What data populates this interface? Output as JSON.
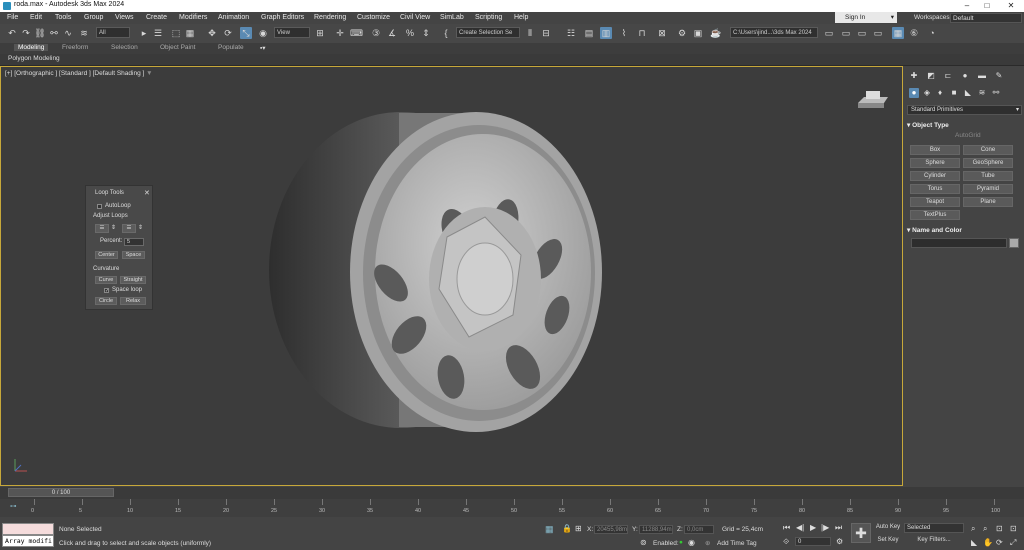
{
  "window": {
    "title": "roda.max - Autodesk 3ds Max 2024",
    "minimize": "–",
    "maximize": "□",
    "close": "✕"
  },
  "menu": [
    "File",
    "Edit",
    "Tools",
    "Group",
    "Views",
    "Create",
    "Modifiers",
    "Animation",
    "Graph Editors",
    "Rendering",
    "Customize",
    "Civil View",
    "SimLab",
    "Scripting",
    "Help"
  ],
  "signin": "Sign In",
  "workspaces": {
    "label": "Workspaces:",
    "value": "Default"
  },
  "toolbar": {
    "filter": "All",
    "refcoord": "View",
    "selection_set": "Create Selection Se",
    "path": "C:\\Users\\jind...\\3ds Max 2024"
  },
  "ribbon": {
    "tabs": [
      "Modeling",
      "Freeform",
      "Selection",
      "Object Paint",
      "Populate"
    ],
    "active": "Modeling",
    "panel": "Polygon Modeling"
  },
  "viewport": {
    "label": "[+] [Orthographic ] [Standard ] [Default Shading ]"
  },
  "loop_tools": {
    "title": "Loop Tools",
    "autoloop": "AutoLoop",
    "adjust_loops": "Adjust Loops",
    "percent_label": "Percent:",
    "percent_value": "5",
    "center": "Center",
    "space": "Space",
    "curvature": "Curvature",
    "curve": "Curve",
    "straight": "Straight",
    "space_loop": "Space loop",
    "circle": "Circle",
    "relax": "Relax"
  },
  "command_panel": {
    "category": "Standard Primitives",
    "object_type_title": "Object Type",
    "autogrid": "AutoGrid",
    "buttons": [
      "Box",
      "Cone",
      "Sphere",
      "GeoSphere",
      "Cylinder",
      "Tube",
      "Torus",
      "Pyramid",
      "Teapot",
      "Plane",
      "TextPlus"
    ],
    "name_color_title": "Name and Color"
  },
  "timeline": {
    "slider": "0 / 100",
    "ticks": [
      "0",
      "5",
      "10",
      "15",
      "20",
      "25",
      "30",
      "35",
      "40",
      "45",
      "50",
      "55",
      "60",
      "65",
      "70",
      "75",
      "80",
      "85",
      "90",
      "95",
      "100"
    ]
  },
  "status": {
    "maxscript": "Array modifi",
    "selected": "None Selected",
    "prompt": "Click and drag to select and scale objects (uniformly)",
    "x_label": "X:",
    "x_value": "20455,98m",
    "y_label": "Y:",
    "y_value": "11288,94m",
    "z_label": "Z:",
    "z_value": "0,0cm",
    "grid": "Grid = 25,4cm",
    "enabled": "Enabled:",
    "add_time_tag": "Add Time Tag",
    "auto_key": "Auto Key",
    "set_key": "Set Key",
    "selected_dd": "Selected",
    "key_filters": "Key Filters...",
    "frame": "0"
  }
}
